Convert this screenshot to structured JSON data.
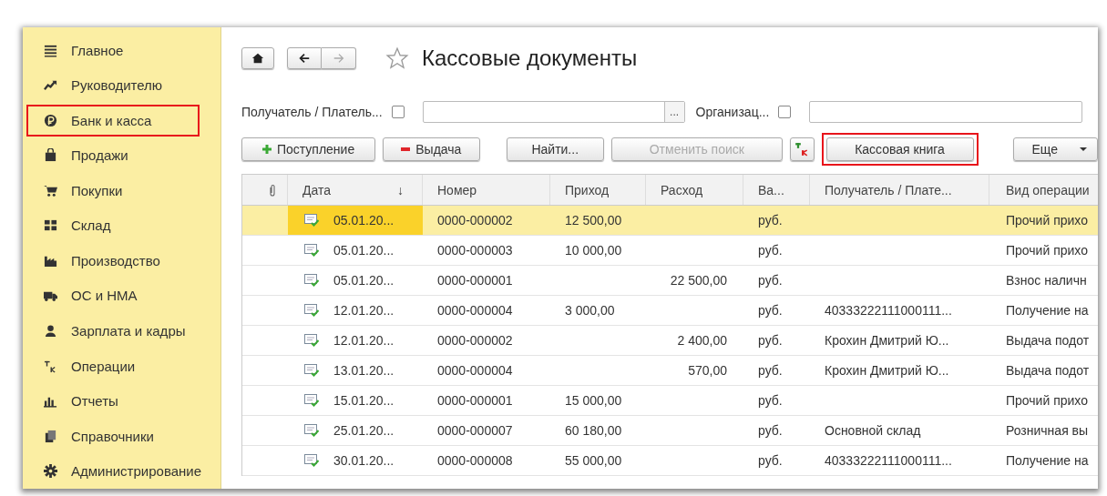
{
  "sidebar": {
    "items": [
      {
        "label": "Главное",
        "highlighted": false
      },
      {
        "label": "Руководителю",
        "highlighted": false
      },
      {
        "label": "Банк и касса",
        "highlighted": true
      },
      {
        "label": "Продажи",
        "highlighted": false
      },
      {
        "label": "Покупки",
        "highlighted": false
      },
      {
        "label": "Склад",
        "highlighted": false
      },
      {
        "label": "Производство",
        "highlighted": false
      },
      {
        "label": "ОС и НМА",
        "highlighted": false
      },
      {
        "label": "Зарплата и кадры",
        "highlighted": false
      },
      {
        "label": "Операции",
        "highlighted": false
      },
      {
        "label": "Отчеты",
        "highlighted": false
      },
      {
        "label": "Справочники",
        "highlighted": false
      },
      {
        "label": "Администрирование",
        "highlighted": false
      }
    ]
  },
  "header": {
    "title": "Кассовые документы",
    "favorite": false
  },
  "filters": [
    {
      "label": "Получатель / Платель...",
      "checked": false,
      "select_button": "..."
    },
    {
      "label": "Организац...",
      "checked": false
    }
  ],
  "toolbar": [
    {
      "kind": "add",
      "label": "Поступление",
      "disabled": false,
      "highlighted": false
    },
    {
      "kind": "remove",
      "label": "Выдача",
      "disabled": false,
      "highlighted": false
    },
    {
      "kind": "plain",
      "label": "Найти...",
      "disabled": false,
      "highlighted": false
    },
    {
      "kind": "plain",
      "label": "Отменить поиск",
      "disabled": true,
      "highlighted": false
    },
    {
      "kind": "icon",
      "disabled": false,
      "highlighted": false
    },
    {
      "kind": "plain",
      "label": "Кассовая книга",
      "disabled": false,
      "highlighted": true
    },
    {
      "kind": "menu",
      "label": "Еще",
      "disabled": false,
      "highlighted": false
    }
  ],
  "table": {
    "columns": [
      "Дата",
      "Номер",
      "Приход",
      "Расход",
      "Ва...",
      "Получатель / Плате...",
      "Вид операции"
    ],
    "sort_indicator": "↓",
    "rows": [
      {
        "selected": true,
        "date": "05.01.20...",
        "number": "0000-000002",
        "income": "12 500,00",
        "expense": "",
        "currency": "руб.",
        "counterparty": "",
        "operation": "Прочий прихо"
      },
      {
        "selected": false,
        "date": "05.01.20...",
        "number": "0000-000003",
        "income": "10 000,00",
        "expense": "",
        "currency": "руб.",
        "counterparty": "",
        "operation": "Прочий прихо"
      },
      {
        "selected": false,
        "date": "05.01.20...",
        "number": "0000-000001",
        "income": "",
        "expense": "22 500,00",
        "currency": "руб.",
        "counterparty": "",
        "operation": "Взнос наличн"
      },
      {
        "selected": false,
        "date": "12.01.20...",
        "number": "0000-000004",
        "income": "3 000,00",
        "expense": "",
        "currency": "руб.",
        "counterparty": "40333222111000111...",
        "operation": "Получение на"
      },
      {
        "selected": false,
        "date": "12.01.20...",
        "number": "0000-000002",
        "income": "",
        "expense": "2 400,00",
        "currency": "руб.",
        "counterparty": "Крохин Дмитрий Ю...",
        "operation": "Выдача подот"
      },
      {
        "selected": false,
        "date": "13.01.20...",
        "number": "0000-000004",
        "income": "",
        "expense": "570,00",
        "currency": "руб.",
        "counterparty": "Крохин Дмитрий Ю...",
        "operation": "Выдача подот"
      },
      {
        "selected": false,
        "date": "15.01.20...",
        "number": "0000-000001",
        "income": "15 000,00",
        "expense": "",
        "currency": "руб.",
        "counterparty": "",
        "operation": "Прочий прихо"
      },
      {
        "selected": false,
        "date": "25.01.20...",
        "number": "0000-000007",
        "income": "60 180,00",
        "expense": "",
        "currency": "руб.",
        "counterparty": "Основной склад",
        "operation": "Розничная вы"
      },
      {
        "selected": false,
        "date": "30.01.20...",
        "number": "0000-000008",
        "income": "55 000,00",
        "expense": "",
        "currency": "руб.",
        "counterparty": "40333222111000111...",
        "operation": "Получение на"
      }
    ]
  }
}
